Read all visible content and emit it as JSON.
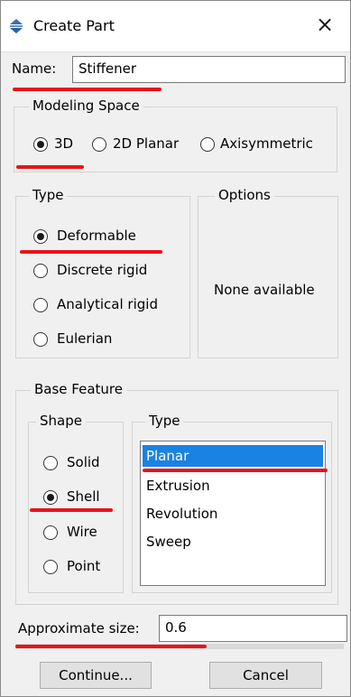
{
  "window": {
    "title": "Create Part",
    "close_glyph": "×",
    "icon": "create-part-icon"
  },
  "name": {
    "label": "Name:",
    "value": "Stiffener"
  },
  "modeling_space": {
    "legend": "Modeling Space",
    "options": [
      "3D",
      "2D Planar",
      "Axisymmetric"
    ],
    "selected": "3D"
  },
  "type": {
    "legend": "Type",
    "options": [
      "Deformable",
      "Discrete rigid",
      "Analytical rigid",
      "Eulerian"
    ],
    "selected": "Deformable"
  },
  "options_group": {
    "legend": "Options",
    "text": "None available"
  },
  "base_feature": {
    "legend": "Base Feature",
    "shape": {
      "legend": "Shape",
      "options": [
        "Solid",
        "Shell",
        "Wire",
        "Point"
      ],
      "selected": "Shell"
    },
    "type": {
      "legend": "Type",
      "items": [
        "Planar",
        "Extrusion",
        "Revolution",
        "Sweep"
      ],
      "selected": "Planar"
    }
  },
  "approximate_size": {
    "label": "Approximate size:",
    "value": "0.6"
  },
  "buttons": {
    "continue": "Continue...",
    "cancel": "Cancel"
  },
  "colors": {
    "annotation": "#e8131a",
    "selection": "#1a82e2"
  }
}
